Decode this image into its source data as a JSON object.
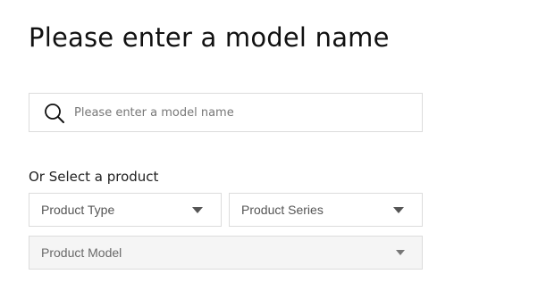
{
  "page": {
    "title": "Please enter a model name"
  },
  "search": {
    "icon": "search-icon",
    "placeholder": "Please enter a model name",
    "value": ""
  },
  "product_selector": {
    "label": "Or Select a product",
    "product_type": {
      "selected": "Product Type",
      "icon": "caret-down-icon"
    },
    "product_series": {
      "selected": "Product Series",
      "icon": "caret-down-icon"
    },
    "product_model": {
      "selected": "Product Model",
      "icon": "caret-down-icon",
      "disabled": true
    }
  },
  "colors": {
    "border": "#dcdcdc",
    "disabled_background": "#f5f5f5",
    "caret": "#555555"
  }
}
